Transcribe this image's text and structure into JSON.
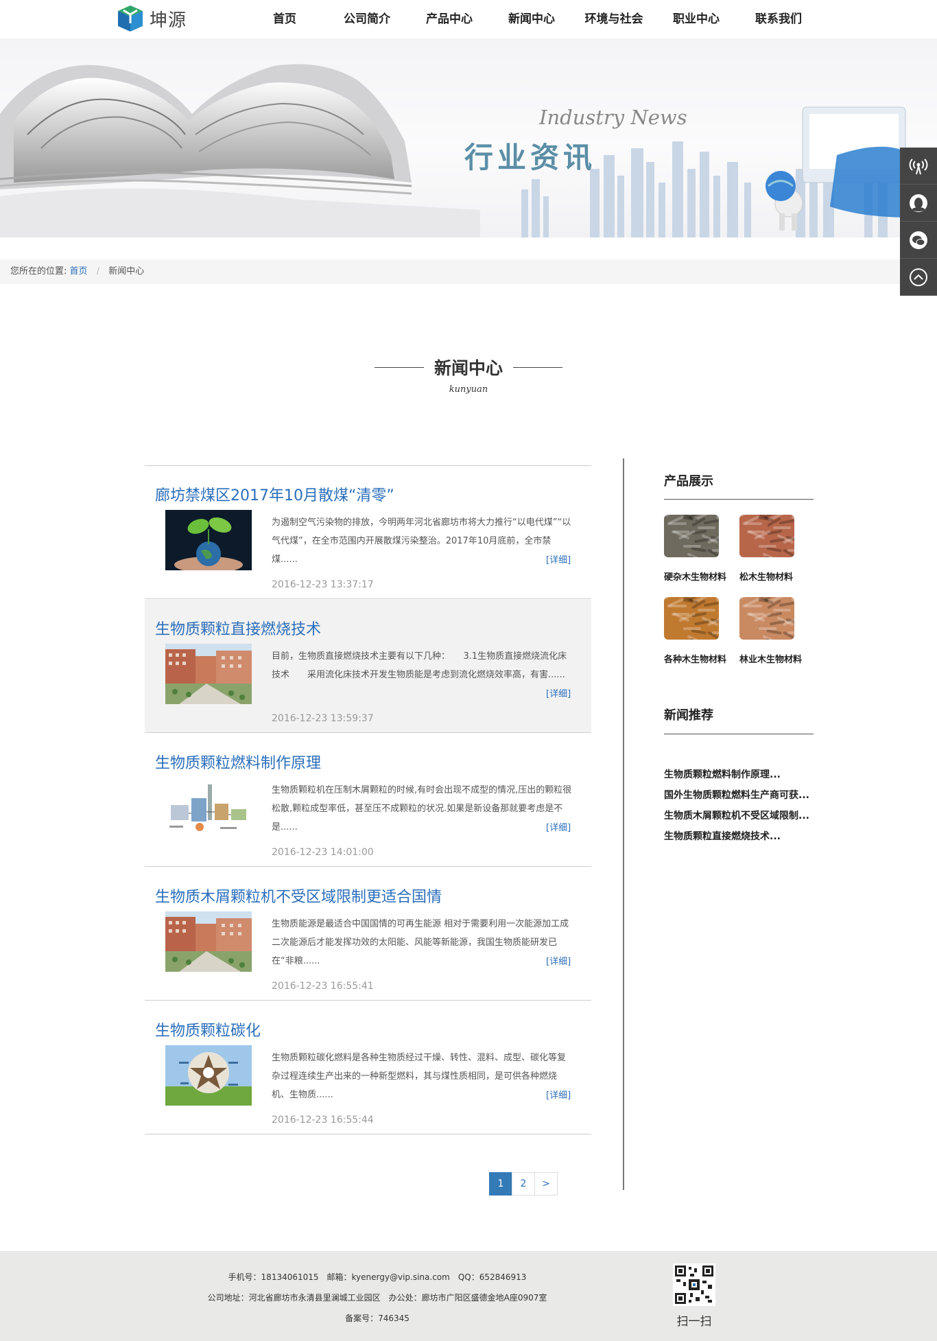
{
  "header": {
    "logo_text": "坤源",
    "nav": [
      "首页",
      "公司简介",
      "产品中心",
      "新闻中心",
      "环境与社会",
      "职业中心",
      "联系我们"
    ]
  },
  "banner": {
    "en": "Industry News",
    "cn": "行业资讯"
  },
  "breadcrumb": {
    "prefix": "您所在的位置:",
    "home": "首页",
    "sep": "/",
    "current": "新闻中心"
  },
  "section": {
    "title": "新闻中心",
    "subtitle": "kunyuan"
  },
  "news": [
    {
      "title": "廊坊禁煤区2017年10月散煤“清零”",
      "summary": "为遏制空气污染物的排放，今明两年河北省廊坊市将大力推行“以电代煤”“以气代煤”，在全市范围内开展散煤污染整治。2017年10月底前，全市禁煤......",
      "detail": "[详细]",
      "date": "2016-12-23 13:37:17",
      "thumb": "plant-globe",
      "highlight": false
    },
    {
      "title": "生物质颗粒直接燃烧技术",
      "summary": "目前，生物质直接燃烧技术主要有以下几种：　　3.1生物质直接燃烧流化床技术　　采用流化床技术开发生物质能是考虑到流化燃烧效率高，有害......",
      "detail": "[详细]",
      "date": "2016-12-23 13:59:37",
      "thumb": "buildings",
      "highlight": true
    },
    {
      "title": "生物质颗粒燃料制作原理",
      "summary": "生物质颗粒机在压制木屑颗粒的时候,有时会出现不成型的情况,压出的颗粒很松散,颗粒成型率低，甚至压不成颗粒的状况.如果是新设备那就要考虑是不是......",
      "detail": "[详细]",
      "date": "2016-12-23 14:01:00",
      "thumb": "diagram",
      "highlight": false
    },
    {
      "title": "生物质木屑颗粒机不受区域限制更适合国情",
      "summary": "生物质能源是最适合中国国情的可再生能源 相对于需要利用一次能源加工成二次能源后才能发挥功效的太阳能、风能等新能源，我国生物质能研发已在“非粮......",
      "detail": "[详细]",
      "date": "2016-12-23 16:55:41",
      "thumb": "buildings",
      "highlight": false
    },
    {
      "title": "生物质颗粒碳化",
      "summary": "生物质颗粒碳化燃料是各种生物质经过干燥、转性、混料、成型、碳化等复杂过程连续生产出来的一种新型燃料，其与煤性质相同，是可供各种燃烧机、生物质......",
      "detail": "[详细]",
      "date": "2016-12-23 16:55:44",
      "thumb": "star",
      "highlight": false
    }
  ],
  "pagination": [
    "1",
    "2",
    ">"
  ],
  "sidebar": {
    "products_title": "产品展示",
    "products": [
      {
        "name": "硬杂木生物材料",
        "color": "#6e6a5e"
      },
      {
        "name": "松木生物材料",
        "color": "#b7664a"
      },
      {
        "name": "各种木生物材料",
        "color": "#c07a30"
      },
      {
        "name": "林业木生物材料",
        "color": "#c98a62"
      }
    ],
    "rec_title": "新闻推荐",
    "recommend": [
      "生物质颗粒燃料制作原理...",
      "国外生物质颗粒燃料生产商可获...",
      "生物质木屑颗粒机不受区域限制...",
      "生物质颗粒直接燃烧技术..."
    ]
  },
  "float_bar": [
    "signal-icon",
    "qq-icon",
    "wechat-icon",
    "back-to-top-icon"
  ],
  "footer": {
    "line1": "手机号：18134061015　邮箱：kyenergy@vip.sina.com　QQ：652846913",
    "line2": "公司地址：河北省廊坊市永清县里澜城工业园区　办公处：廊坊市广阳区盛德金地A座0907室",
    "line3": "备案号：746345",
    "qr_label": "扫一扫"
  }
}
